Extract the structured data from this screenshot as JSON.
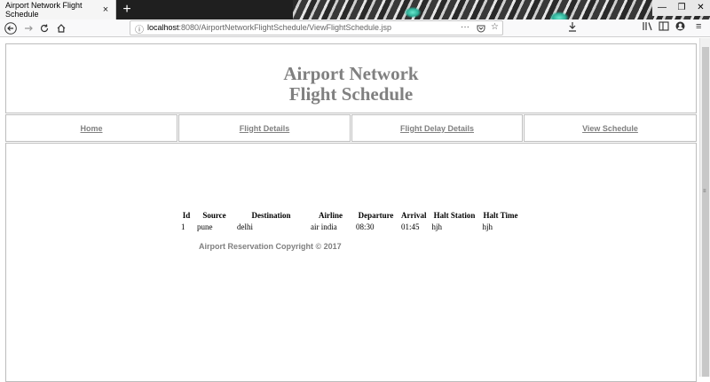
{
  "browser": {
    "tab_title": "Airport Network Flight Schedule",
    "tab_close": "×",
    "new_tab": "+",
    "url_host": "localhost",
    "url_rest": ":8080/AirportNetworkFlightSchedule/ViewFlightSchedule.jsp",
    "menu_dots": "···",
    "info_icon": "info-icon"
  },
  "header": {
    "title_line1": "Airport Network",
    "title_line2": "Flight Schedule"
  },
  "nav": {
    "items": [
      {
        "label": "Home"
      },
      {
        "label": "Flight Details"
      },
      {
        "label": "Flight Delay Details"
      },
      {
        "label": "View Schedule"
      }
    ]
  },
  "schedule": {
    "columns": [
      "Id",
      "Source",
      "Destination",
      "Airline",
      "Departure",
      "Arrival",
      "Halt Station",
      "Halt Time"
    ],
    "rows": [
      [
        "1",
        "pune",
        "delhi",
        "air india",
        "08:30",
        "01:45",
        "hjh",
        "hjh"
      ]
    ]
  },
  "footer": {
    "copyright": "Airport Reservation Copyright © 2017"
  }
}
